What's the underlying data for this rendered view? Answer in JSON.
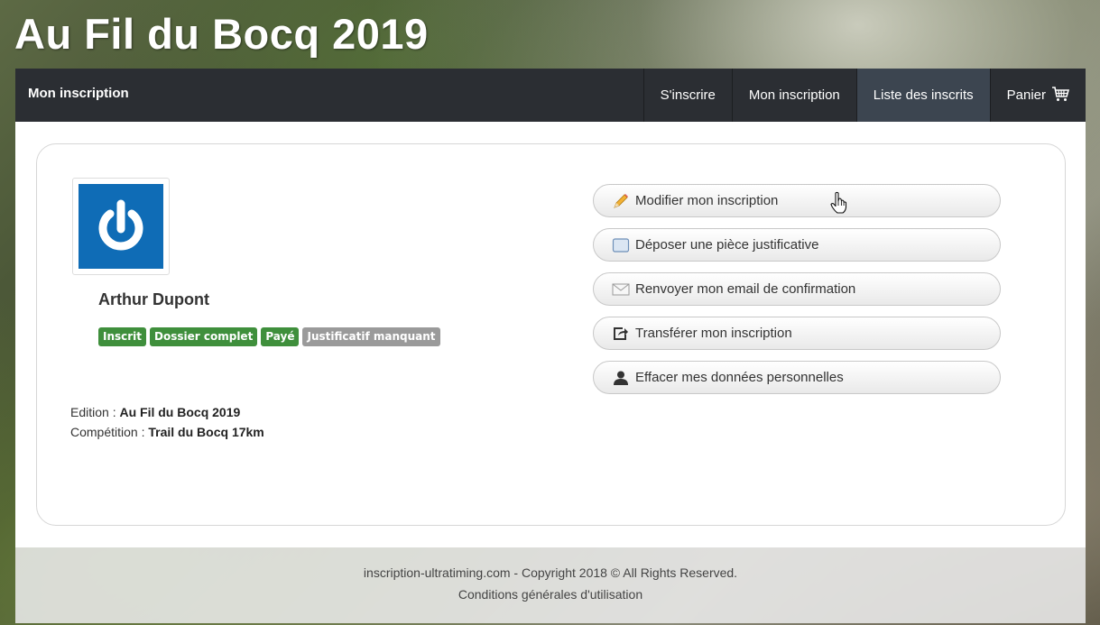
{
  "site": {
    "title": "Au Fil du Bocq 2019"
  },
  "navbar": {
    "brand": "Mon inscription",
    "items": [
      {
        "label": "S'inscrire"
      },
      {
        "label": "Mon inscription"
      },
      {
        "label": "Liste des inscrits"
      },
      {
        "label": "Panier",
        "icon": "cart-icon"
      }
    ]
  },
  "profile": {
    "name": "Arthur Dupont",
    "badges": [
      {
        "label": "Inscrit",
        "color": "#3f8f3c"
      },
      {
        "label": "Dossier complet",
        "color": "#3f8f3c"
      },
      {
        "label": "Payé",
        "color": "#3f8f3c"
      },
      {
        "label": "Justificatif manquant",
        "color": "#9a9a9a"
      }
    ],
    "edition_label": "Edition :",
    "edition_value": "Au Fil du Bocq 2019",
    "competition_label": "Compétition :",
    "competition_value": "Trail du Bocq 17km"
  },
  "actions": [
    {
      "label": "Modifier mon inscription",
      "icon": "pencil-icon"
    },
    {
      "label": "Déposer une pièce justificative",
      "icon": "document-icon"
    },
    {
      "label": "Renvoyer mon email de confirmation",
      "icon": "envelope-icon"
    },
    {
      "label": "Transférer mon inscription",
      "icon": "share-icon"
    },
    {
      "label": "Effacer mes données personnelles",
      "icon": "user-icon"
    }
  ],
  "footer": {
    "copyright": "inscription-ultratiming.com - Copyright 2018 © All Rights Reserved.",
    "terms": "Conditions générales d'utilisation"
  }
}
